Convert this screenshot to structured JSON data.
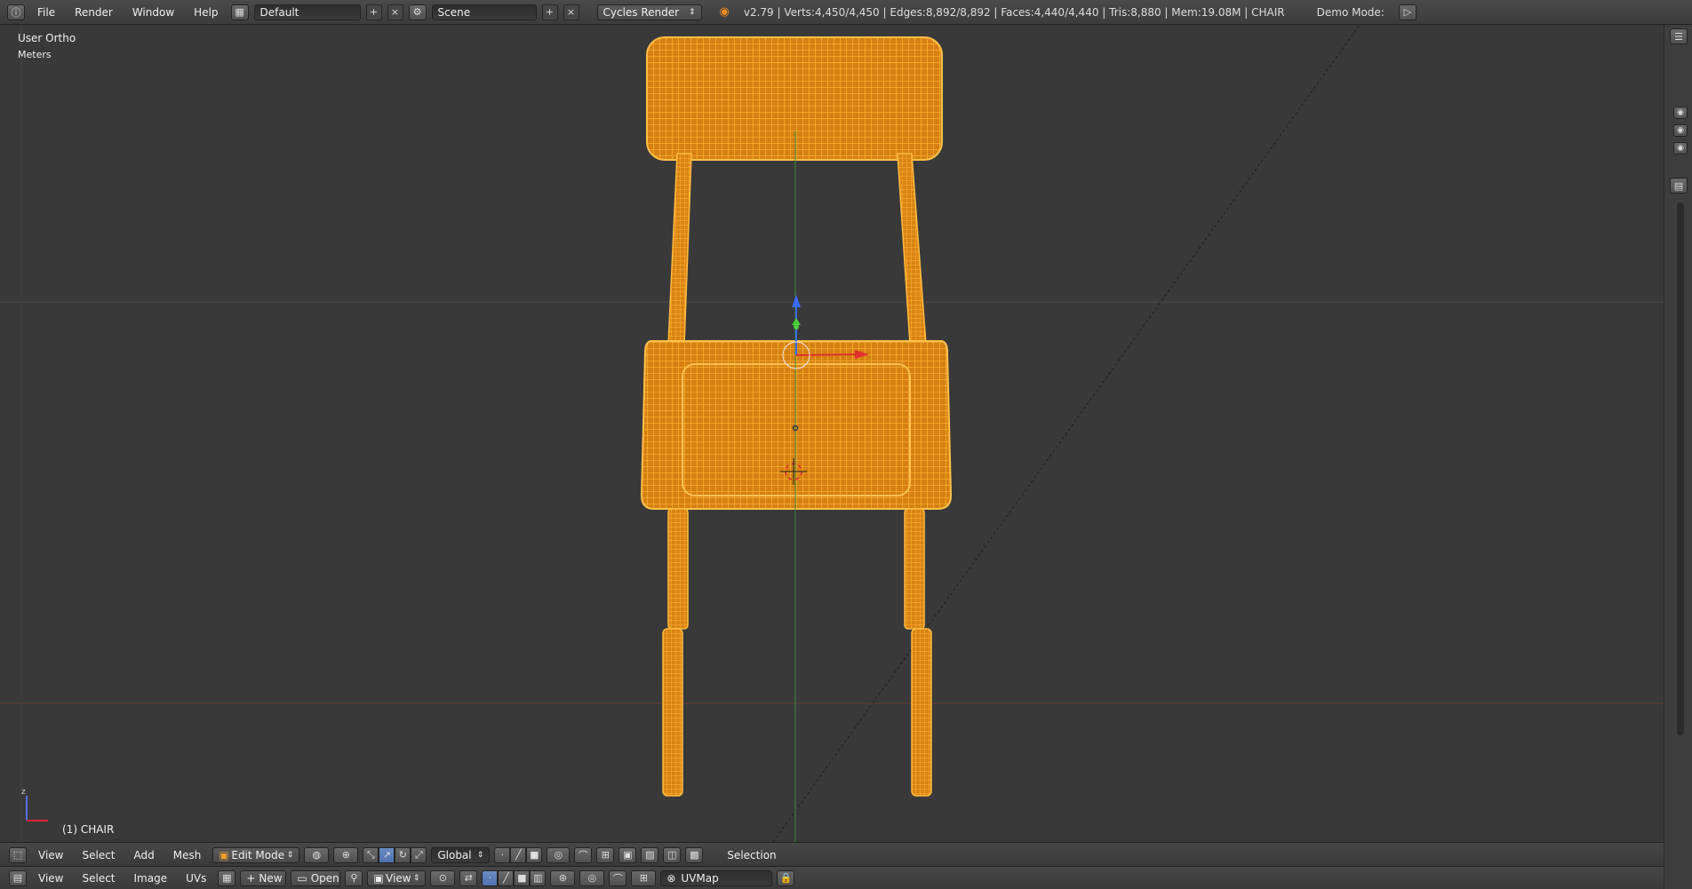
{
  "topbar": {
    "menus": [
      "File",
      "Render",
      "Window",
      "Help"
    ],
    "screen_layout": "Default",
    "scene": "Scene",
    "render_engine": "Cycles Render",
    "stats": "v2.79 | Verts:4,450/4,450 | Edges:8,892/8,892 | Faces:4,440/4,440 | Tris:8,880 | Mem:19.08M | CHAIR",
    "demo_mode_label": "Demo Mode:"
  },
  "viewport": {
    "view_name": "User Ortho",
    "units": "Meters",
    "object_label": "(1) CHAIR",
    "wire_color": "#ffa61a"
  },
  "view3d_header": {
    "menus": [
      "View",
      "Select",
      "Add",
      "Mesh"
    ],
    "mode": "Edit Mode",
    "orientation": "Global",
    "status": "Selection"
  },
  "uv_header": {
    "menus": [
      "View",
      "Select",
      "Image",
      "UVs"
    ],
    "new_label": "New",
    "open_label": "Open",
    "view_label": "View",
    "uvmap": "UVMap"
  }
}
